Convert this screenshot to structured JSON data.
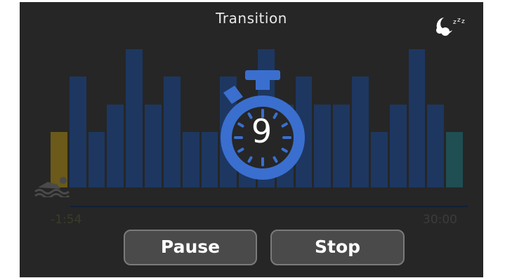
{
  "header": {
    "title": "Transition",
    "sleep_icon": "sleep-moon-zzz-icon"
  },
  "chart": {
    "tick_left": "-1:54",
    "tick_right": "30:00",
    "levels": [
      2,
      4,
      2,
      3,
      5,
      3,
      4,
      2,
      2,
      4,
      2,
      5,
      3,
      4,
      3,
      3,
      4,
      2,
      3,
      5,
      3,
      2
    ],
    "bar_colors": {
      "swim": "#6b5a1a",
      "bike": "#1d3761",
      "run": "#1f4e53"
    }
  },
  "countdown": {
    "value": "9",
    "icon": "stopwatch-icon",
    "color": "#3a6fcf"
  },
  "controls": {
    "pause_label": "Pause",
    "stop_label": "Stop"
  },
  "sport_icon": "swim-icon"
}
